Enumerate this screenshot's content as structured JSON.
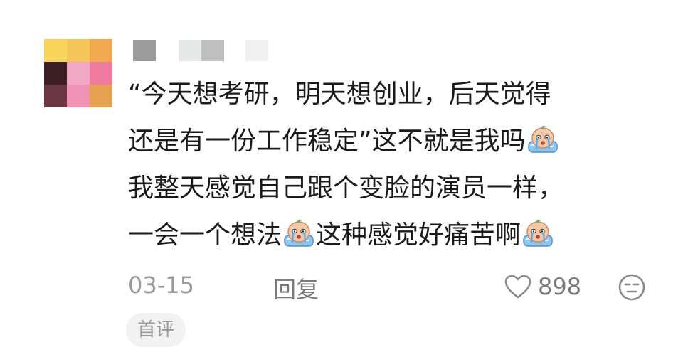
{
  "avatar": {
    "colors": [
      "#f7d55a",
      "#f5c75a",
      "#f1a84f",
      "#3a1f25",
      "#f1a8c4",
      "#f07aa0",
      "#6b3743",
      "#ef92b4",
      "#e6a251"
    ]
  },
  "username": {
    "blocks": [
      "#9c9c9c",
      "#e4e8e6",
      "#bfbfbf",
      "#f0f0f0"
    ]
  },
  "comment": {
    "lines": [
      [
        "“今天想考研，明天想创业，后天觉得"
      ],
      [
        "还是有一份工作稳定”这不就是我吗",
        "crying-emoji"
      ],
      [
        "我整天感觉自己跟个变脸的演员一样，"
      ],
      [
        "一会一个想法",
        "crying-emoji",
        "这种感觉好痛苦啊",
        "crying-emoji"
      ]
    ]
  },
  "meta": {
    "date": "03-15",
    "reply_label": "回复",
    "like_count": "898"
  },
  "badge": {
    "label": "首评"
  }
}
